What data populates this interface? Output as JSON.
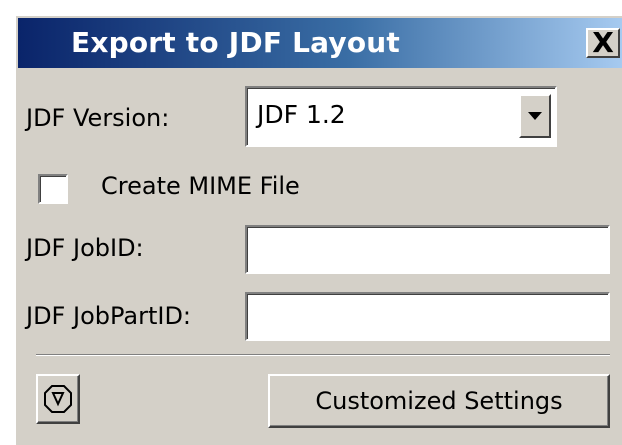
{
  "dialog": {
    "title": "Export to JDF Layout",
    "close_label": "X"
  },
  "form": {
    "version_label": "JDF Version:",
    "version_value": "JDF 1.2",
    "mime_checkbox_label": "Create MIME File",
    "mime_checked": false,
    "jobid_label": "JDF JobID:",
    "jobid_value": "",
    "jobpartid_label": "JDF JobPartID:",
    "jobpartid_value": ""
  },
  "buttons": {
    "settings_icon": "stop-octagon-icon",
    "customized_label": "Customized Settings"
  }
}
